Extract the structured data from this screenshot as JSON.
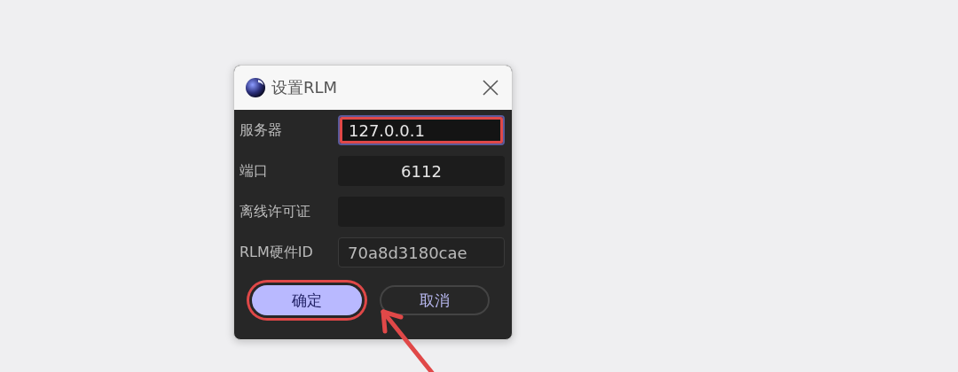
{
  "dialog": {
    "title": "设置RLM"
  },
  "fields": [
    {
      "label": "服务器",
      "value": "127.0.0.1",
      "kind": "text",
      "focused": true,
      "highlighted": true
    },
    {
      "label": "端口",
      "value": "6112",
      "kind": "number",
      "focused": false,
      "highlighted": false
    },
    {
      "label": "离线许可证",
      "kind": "text",
      "focused": false,
      "highlighted": false
    },
    {
      "label": "RLM硬件ID",
      "value": "70a8d3180cae",
      "kind": "readonly",
      "focused": false,
      "highlighted": false
    }
  ],
  "buttons": [
    {
      "label": "确定",
      "primary": true,
      "highlighted": true
    },
    {
      "label": "取消",
      "primary": false,
      "highlighted": false
    }
  ],
  "annotation": {
    "kind": "arrow"
  }
}
